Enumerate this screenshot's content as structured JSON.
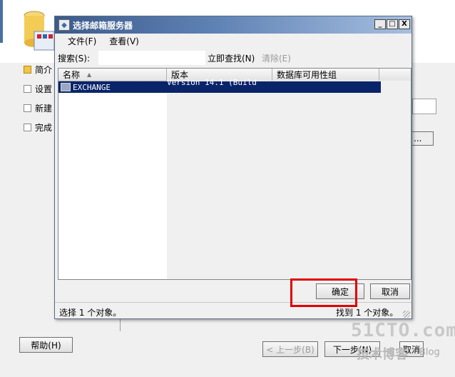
{
  "wizard": {
    "steps": [
      "简介",
      "设置",
      "新建",
      "完成"
    ],
    "browse_label": "...",
    "back_label": "< 上一步(B)",
    "next_label": "下一步(N)",
    "cancel_label": "取消",
    "help_label": "帮助(H)"
  },
  "dialog": {
    "title": "选择邮箱服务器",
    "controls": {
      "minimize": "_",
      "maximize": "□",
      "close": "X"
    },
    "menu": [
      "文件(F)",
      "查看(V)"
    ],
    "search": {
      "label": "搜索(S):",
      "value": "",
      "search_now": "立即查找(N)",
      "clear": "清除(E)"
    },
    "columns": [
      "名称",
      "版本",
      "数据库可用性组"
    ],
    "rows": [
      {
        "name": "EXCHANGE",
        "version": "Version 14.1 (Build ...",
        "dag": ""
      }
    ],
    "ok_label": "确定",
    "cancel_label": "取消",
    "status_left": "选择 1 个对象。",
    "status_right": "找到 1 个对象。"
  },
  "watermark": {
    "main": "51CTO.com",
    "sub": "技术博客",
    "blog": "Blog"
  },
  "colors": {
    "title_gradient_start": "#3b5b8a",
    "selection": "#0a246a",
    "highlight_box": "#e00000"
  }
}
